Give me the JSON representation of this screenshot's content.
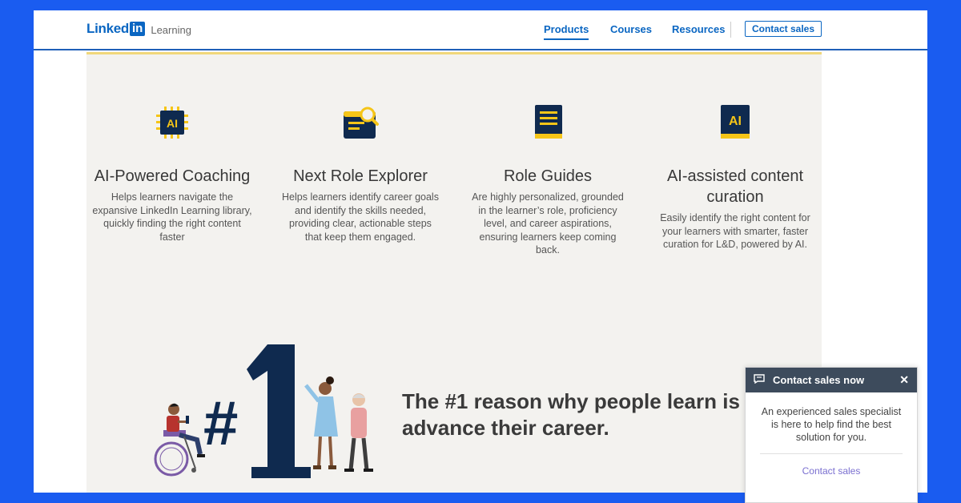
{
  "header": {
    "logo_word": "Linked",
    "logo_box": "in",
    "logo_sub": "Learning",
    "nav": [
      "Products",
      "Courses",
      "Resources"
    ],
    "active_nav": "Products",
    "contact_button": "Contact sales"
  },
  "features": [
    {
      "icon": "ai-chip-icon",
      "title": "AI-Powered Coaching",
      "description": "Helps learners navigate the expansive LinkedIn Learning library, quickly finding the right content faster"
    },
    {
      "icon": "document-search-icon",
      "title": "Next Role Explorer",
      "description": "Helps learners identify career goals and identify the skills needed, providing clear, actionable steps that keep them engaged."
    },
    {
      "icon": "book-icon",
      "title": "Role Guides",
      "description": "Are highly personalized, grounded in the learner’s role, proficiency level, and career aspirations, ensuring learners keep coming back."
    },
    {
      "icon": "ai-book-icon",
      "title": "AI-assisted content curation",
      "description": "Easily identify the right content for your learners with smarter, faster curation for L&D, powered by AI."
    }
  ],
  "hero": {
    "illustration_label": "#1",
    "text": "The #1 reason why people learn is to advance their career."
  },
  "chat": {
    "title": "Contact sales now",
    "close": "✕",
    "body": "An experienced sales specialist is here to help find the best solution for you.",
    "link": "Contact sales"
  },
  "colors": {
    "frame": "#1a5cf0",
    "brand": "#0a66c2",
    "panel": "#f3f2ef",
    "navy": "#0f2a4f",
    "gold": "#f5c518",
    "chat_header": "#3d4b5c",
    "chat_link": "#7a6fd0"
  }
}
